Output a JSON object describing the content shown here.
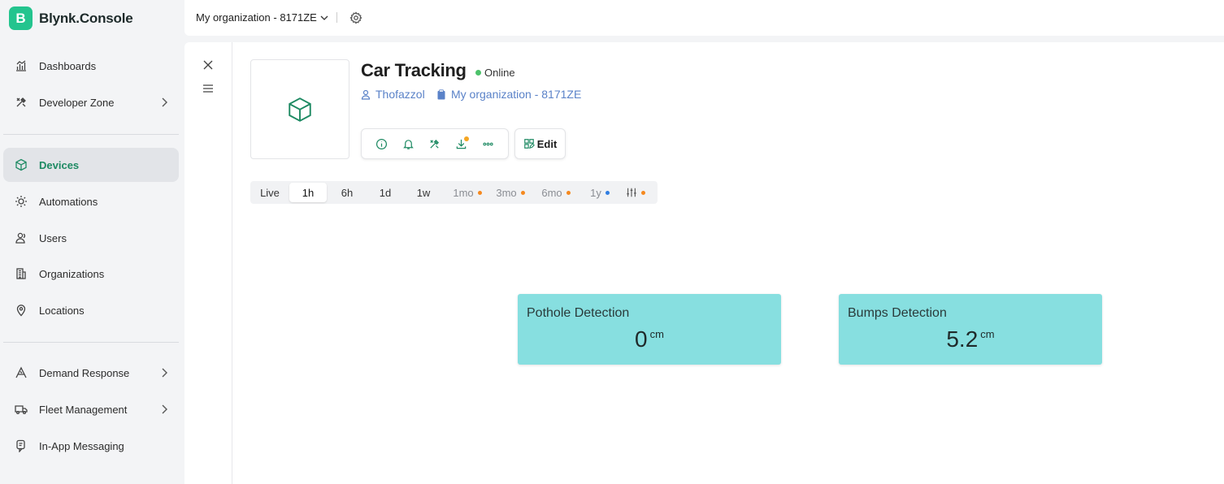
{
  "app": {
    "logo_letter": "B",
    "title": "Blynk.Console"
  },
  "topbar": {
    "organization": "My organization - 8171ZE"
  },
  "sidebar": {
    "items": [
      {
        "label": "Dashboards",
        "icon": "bar-chart-icon"
      },
      {
        "label": "Developer Zone",
        "icon": "tools-icon",
        "has_submenu": true
      },
      {
        "label": "Devices",
        "icon": "cube-icon",
        "active": true
      },
      {
        "label": "Automations",
        "icon": "sun-gear-icon"
      },
      {
        "label": "Users",
        "icon": "users-icon"
      },
      {
        "label": "Organizations",
        "icon": "building-icon"
      },
      {
        "label": "Locations",
        "icon": "map-pin-icon"
      },
      {
        "label": "Demand Response",
        "icon": "signal-icon",
        "has_submenu": true
      },
      {
        "label": "Fleet Management",
        "icon": "truck-icon",
        "has_submenu": true
      },
      {
        "label": "In-App Messaging",
        "icon": "message-icon"
      }
    ]
  },
  "device": {
    "name": "Car Tracking",
    "status": "Online",
    "status_color": "#4cc26a",
    "owner": "Thofazzol",
    "organization": "My organization - 8171ZE",
    "edit_label": "Edit"
  },
  "time_ranges": [
    {
      "label": "Live"
    },
    {
      "label": "1h",
      "active": true
    },
    {
      "label": "6h"
    },
    {
      "label": "1d"
    },
    {
      "label": "1w"
    },
    {
      "label": "1mo",
      "dot": "#f5891f"
    },
    {
      "label": "3mo",
      "dot": "#f5891f"
    },
    {
      "label": "6mo",
      "dot": "#f5891f"
    },
    {
      "label": "1y",
      "dot": "#2f7de1"
    },
    {
      "label": "",
      "icon": "sliders-icon",
      "dot": "#f5891f"
    }
  ],
  "widgets": [
    {
      "title": "Pothole Detection",
      "value": "0",
      "unit": "cm"
    },
    {
      "title": "Bumps Detection",
      "value": "5.2",
      "unit": "cm"
    }
  ],
  "colors": {
    "brand": "#23c48e",
    "accent_text": "#1e8a63",
    "link": "#5a82c8",
    "widget_bg": "#87dfe0"
  }
}
